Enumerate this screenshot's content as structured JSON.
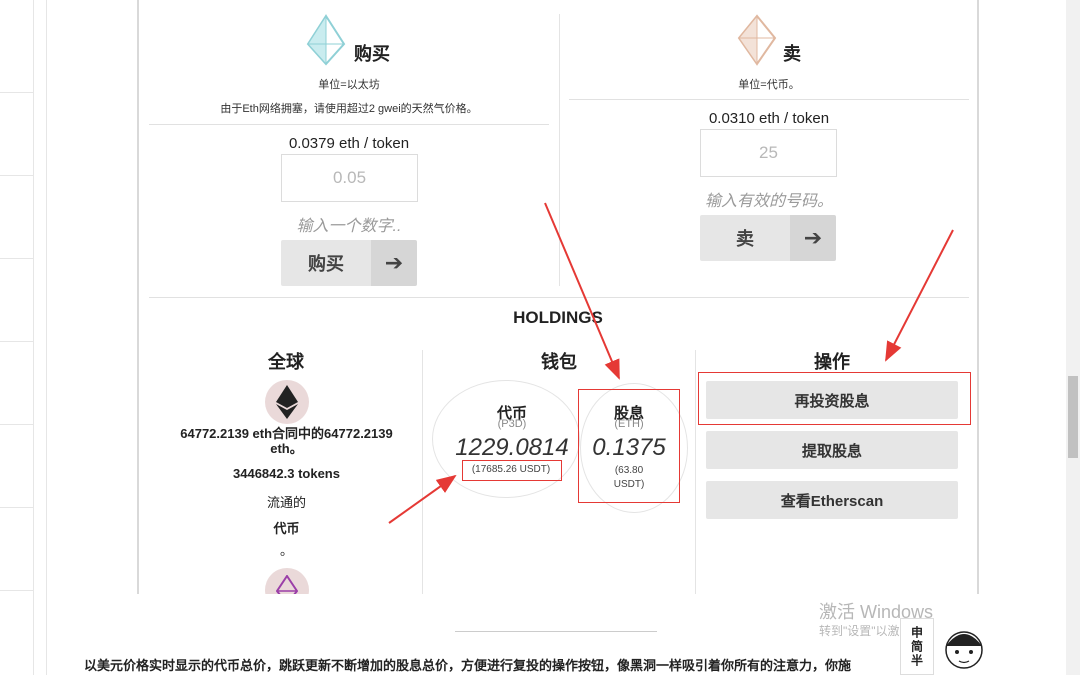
{
  "buy": {
    "title": "购买",
    "unit": "单位=以太坊",
    "notice": "由于Eth网络拥塞，请使用超过2 gwei的天然气价格。",
    "price": "0.0379 eth / token",
    "input_placeholder": "0.05",
    "hint": "输入一个数字..",
    "button_label": "购买",
    "button_arrow": "➔"
  },
  "sell": {
    "title": "卖",
    "unit": "单位=代币。",
    "price": "0.0310 eth / token",
    "input_placeholder": "25",
    "hint": "输入有效的号码。",
    "button_label": "卖",
    "button_arrow": "➔"
  },
  "holdings": {
    "title": "HOLDINGS",
    "global": {
      "title": "全球",
      "eth_text": "64772.2139 eth合同中的64772.2139 eth。",
      "tokens": "3446842.3 tokens",
      "circulating": "流通的",
      "token_word": "代币",
      "dot": "。"
    },
    "wallet": {
      "title": "钱包",
      "token_label": "代币",
      "token_unit": "(P3D)",
      "token_value": "1229.0814",
      "token_usd": "(17685.26 USDT)",
      "div_label": "股息",
      "div_unit": "(ETH)",
      "div_value": "0.1375",
      "div_usd": "(63.80 USDT)"
    },
    "actions": {
      "title": "操作",
      "reinvest": "再投资股息",
      "withdraw": "提取股息",
      "etherscan": "查看Etherscan"
    }
  },
  "caption": "以美元价格实时显示的代币总价，跳跃更新不断增加的股息总价，方便进行复投的操作按钮，像黑洞一样吸引着你所有的注意力，你施",
  "watermark": {
    "line1": "激活 Windows",
    "line2": "转到\"设置\"以激活 Windows。"
  },
  "sticker": {
    "text": "申简半"
  },
  "colors": {
    "accent_red": "#e53935",
    "button_gray": "#e6e6e6"
  }
}
